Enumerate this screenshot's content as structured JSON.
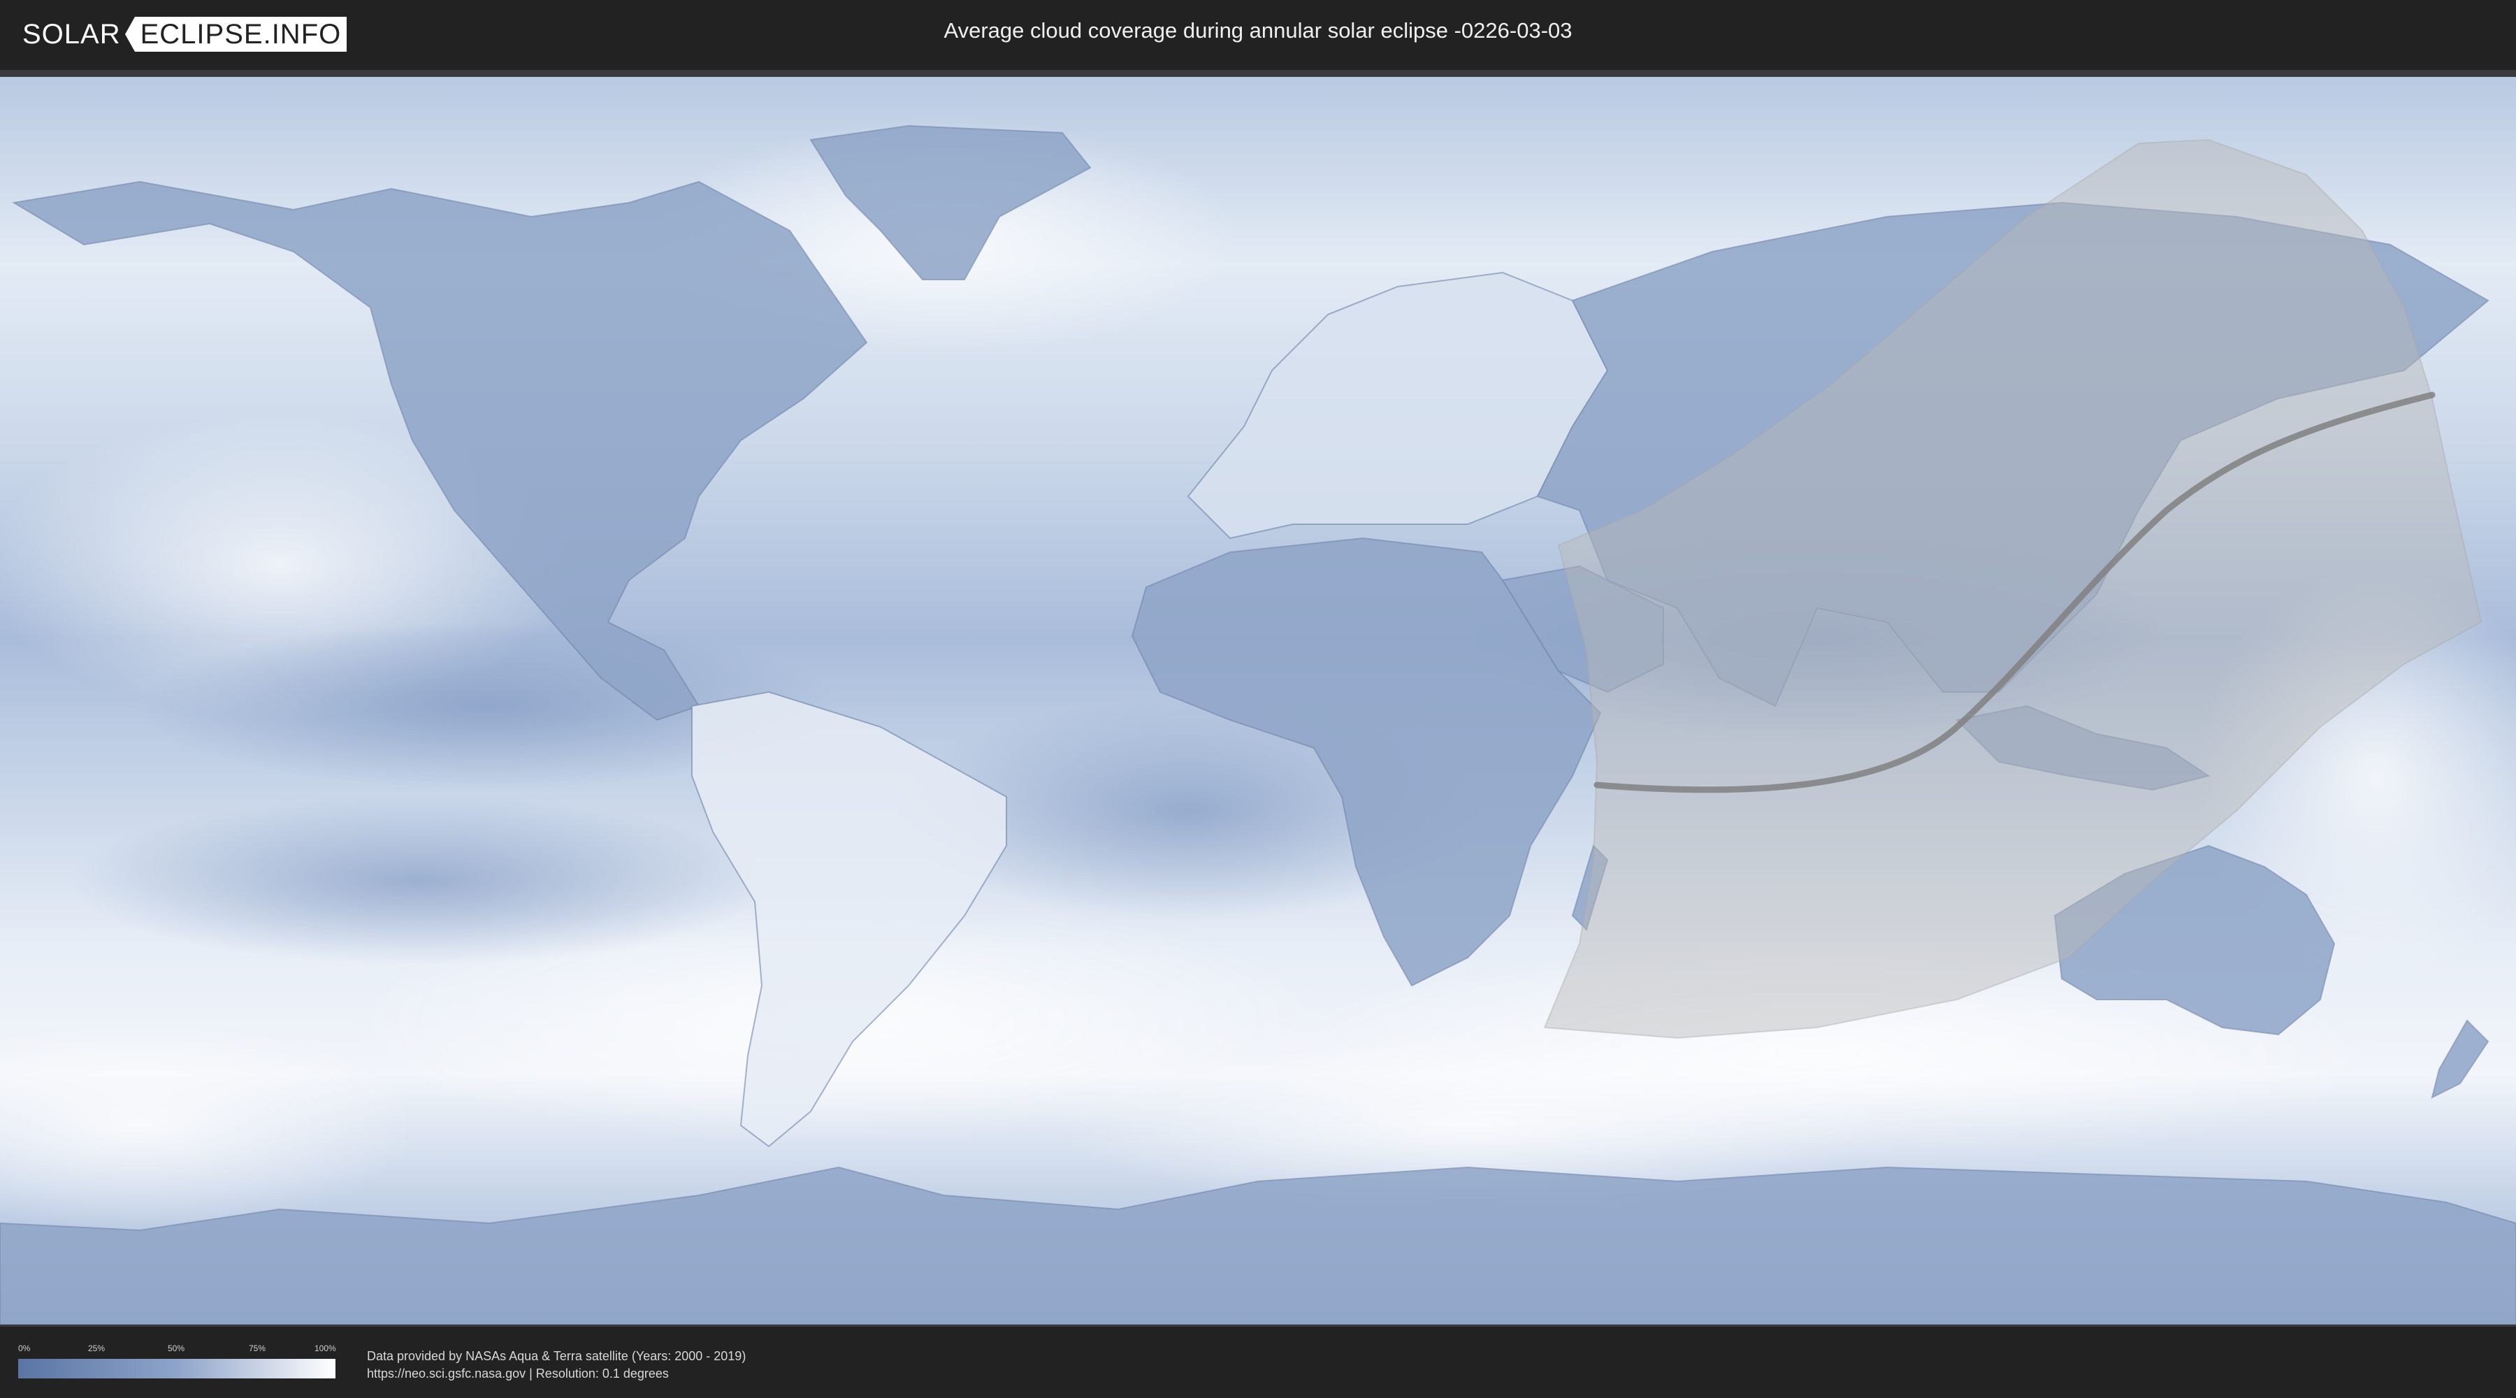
{
  "header": {
    "logo_left": "SOLAR",
    "logo_right": "ECLIPSE.INFO",
    "title": "Average cloud coverage during annular solar eclipse -0226-03-03"
  },
  "legend": {
    "ticks": [
      "0%",
      "25%",
      "50%",
      "75%",
      "100%"
    ],
    "colors": {
      "low": "#5a75a5",
      "high": "#ffffff"
    }
  },
  "credits": {
    "line1": "Data provided by NASAs Aqua & Terra satellite (Years: 2000 - 2019)",
    "line2": "https://neo.sci.gsfc.nasa.gov | Resolution: 0.1 degrees"
  },
  "map": {
    "ocean_color": "#c9d6e8",
    "land_color": "#8fa5c8",
    "eclipse_zone_color": "#b8b8b8",
    "central_line_color": "#808080"
  }
}
